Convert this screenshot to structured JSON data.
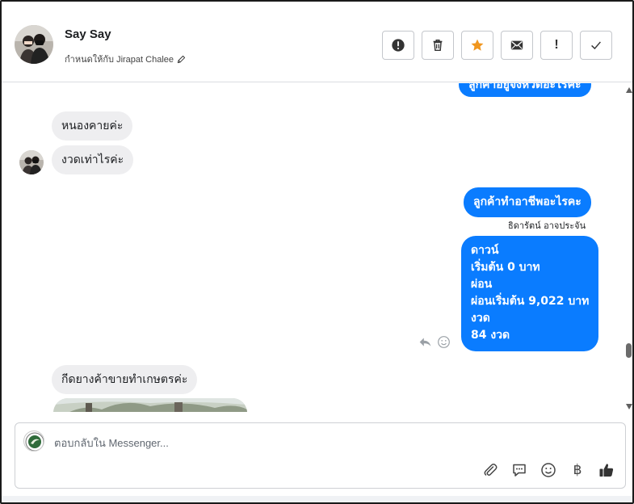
{
  "header": {
    "name": "Say Say",
    "assigned_to": "กำหนดให้กับ Jirapat Chalee",
    "toolbar": [
      {
        "name": "spam-button",
        "icon": "alert-circle-icon"
      },
      {
        "name": "delete-button",
        "icon": "trash-icon"
      },
      {
        "name": "star-button",
        "icon": "star-icon",
        "color": "#f0961e"
      },
      {
        "name": "mark-unread-button",
        "icon": "envelope-icon"
      },
      {
        "name": "follow-up-button",
        "icon": "exclamation-icon",
        "glyph": "!"
      },
      {
        "name": "done-button",
        "icon": "checkmark-icon"
      }
    ]
  },
  "messages": {
    "partial_top": "ลูกค้าอยู่จังหวัดอะไรคะ",
    "in_1": "หนองคายค่ะ",
    "in_2": "งวดเท่าไรค่ะ",
    "out_1": "ลูกค้าทำอาชีพอะไรคะ",
    "out_1_sender": "ธิดารัตน์ อาจประจัน",
    "out_2_lines": [
      "ดาวน์",
      "เริ่มต้น 0 บาท",
      "ผ่อน",
      "ผ่อนเริ่มต้น 9,022 บาท",
      "งวด",
      "84 งวด"
    ],
    "in_3": "กีดยางค้าขายทำเกษตรค่ะ"
  },
  "composer": {
    "placeholder": "ตอบกลับใน Messenger...",
    "tools": [
      "paperclip-icon",
      "saved-reply-icon",
      "emoji-icon",
      "baht-icon",
      "thumbs-up-icon"
    ],
    "baht_glyph": "฿"
  },
  "colors": {
    "outgoing": "#0a7cff",
    "incoming": "#eeeef0",
    "star": "#f0961e"
  }
}
